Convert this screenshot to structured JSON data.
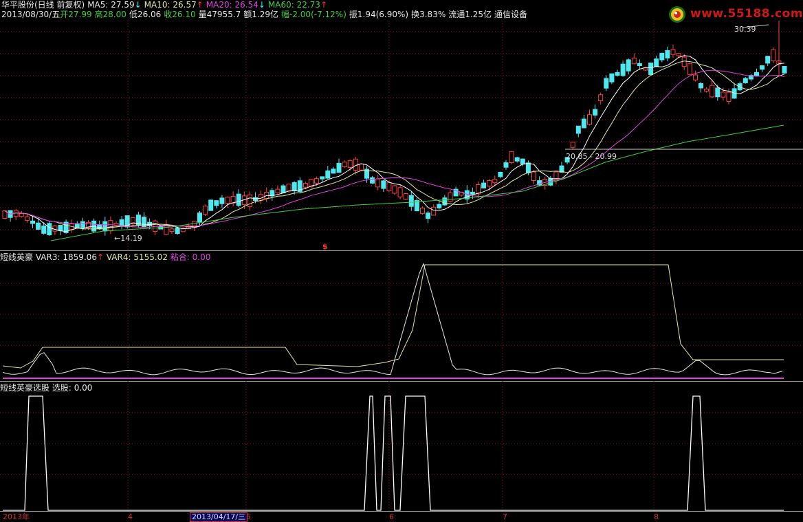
{
  "header": {
    "stock": "华平股份(日线 前复权)",
    "ma5_label": "MA5: 27.59",
    "ma10_label": "MA10: 26.57",
    "ma20_label": "MA20: 26.54",
    "ma60_label": "MA60: 22.73",
    "date": "2013/08/30/五",
    "open": "开27.99",
    "high": "高28.00",
    "low": "低26.06",
    "close": "收26.10",
    "volume": "量47955.7",
    "amount": "额1.29亿",
    "change": "幅-2.00(-7.12%)",
    "amplitude": "振1.94(6.90%)",
    "turnover": "换3.83%",
    "float": "流通1.25亿",
    "sector": "通信设备"
  },
  "logo": {
    "text": "www.55188.com"
  },
  "annotations": {
    "high_mark": "30.39",
    "low_mark": "←14.19",
    "range_mark": "20.85 - 20.99",
    "dollar": "$"
  },
  "indicator1": {
    "name": "短线英豪",
    "var3": "VAR3: 1859.06",
    "var4": "VAR4: 5155.02",
    "zhanhe": "粘合: 0.00"
  },
  "indicator2": {
    "name": "短线英豪选股",
    "xuangu": "选股: 0.00"
  },
  "axis": {
    "year": "2013年",
    "months": [
      "4",
      "5",
      "6",
      "7",
      "8"
    ],
    "cursor_date": "2013/04/17/三"
  },
  "colors": {
    "up": "#ff4040",
    "down": "#4ee8f0",
    "ma5": "#ffffff",
    "ma10": "#e8e8a0",
    "ma20": "#e040e0",
    "ma60": "#40d040",
    "grid": "#8b1a1a"
  }
}
